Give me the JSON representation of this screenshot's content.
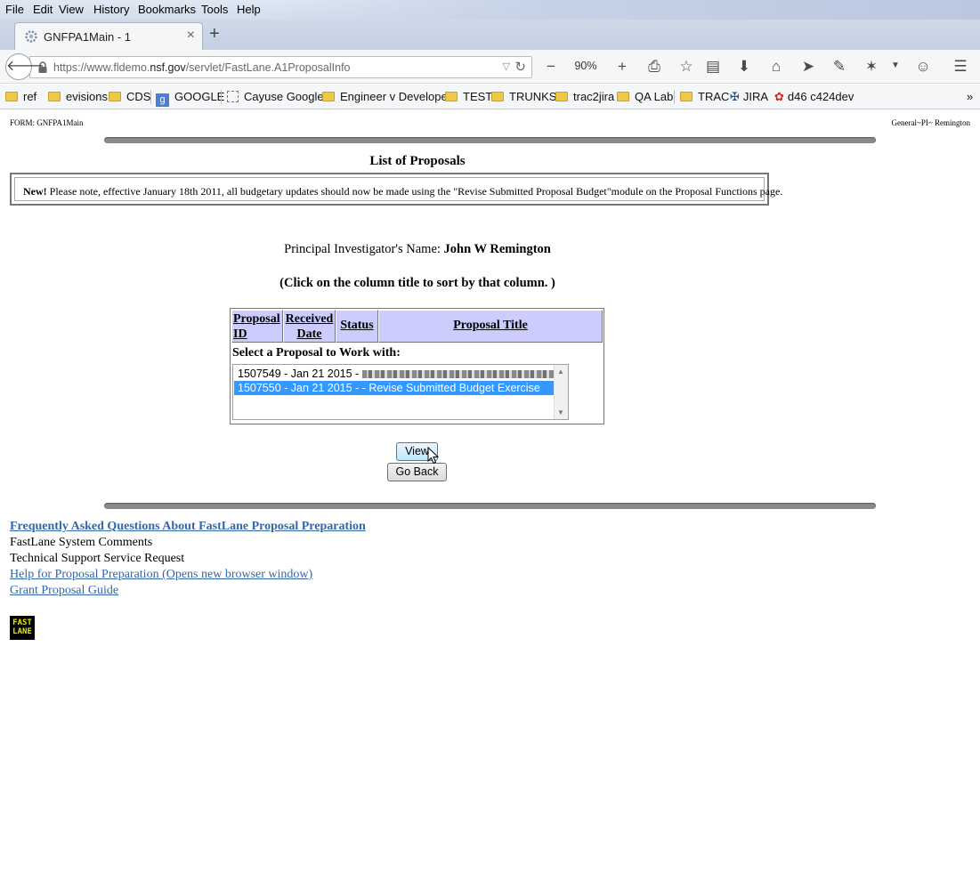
{
  "menubar": {
    "items": [
      "File",
      "Edit",
      "View",
      "History",
      "Bookmarks",
      "Tools",
      "Help"
    ]
  },
  "tabs": {
    "active_title": "GNFPA1Main - 1",
    "close_glyph": "×",
    "new_tab_glyph": "+"
  },
  "navbar": {
    "url_prefix": "https://www.fldemo.",
    "url_domain": "nsf.gov",
    "url_path": "/servlet/FastLane.A1ProposalInfo",
    "zoom": "90%"
  },
  "bookmarks": {
    "items": [
      "ref",
      "evisions",
      "CDS",
      "GOOGLE",
      "Cayuse Google",
      "Engineer v Developer",
      "TEST",
      "TRUNKS",
      "trac2jira",
      "QA Lab",
      "TRAC",
      "JIRA",
      "d46 c424dev"
    ],
    "overflow_glyph": "»"
  },
  "page": {
    "form_label": "FORM: GNFPA1Main",
    "user_label": "General~PI~ Remington",
    "title": "List of Proposals",
    "notice_new": "New!",
    "notice_text": " Please note, effective January 18th 2011, all budgetary updates should now be made using the \"Revise Submitted Proposal Budget\"module on the Proposal Functions page.",
    "pi_label": "Principal Investigator's Name: ",
    "pi_name": "John W Remington",
    "click_hint": "(Click on the column title to sort by that column. )",
    "table": {
      "col_proposal_id": "Proposal ID",
      "col_received_date": "Received Date",
      "col_status": "Status",
      "col_proposal_title": "Proposal Title",
      "select_label": "Select a Proposal to Work with:",
      "options": [
        {
          "text": "1507549 - Jan 21 2015 - ",
          "selected": false
        },
        {
          "text": "1507550 - Jan 21 2015 - - Revise Submitted Budget Exercise",
          "selected": true
        }
      ]
    },
    "view_button": "View",
    "go_back_button": "Go Back",
    "links": {
      "faq": "Frequently Asked Questions About FastLane Proposal Preparation",
      "system_comments": "FastLane System Comments",
      "tech_support": "Technical Support Service Request",
      "help": "Help for Proposal Preparation  (Opens new browser window)",
      "grant_guide": "Grant Proposal Guide"
    },
    "logo_text": "FAST LANE"
  },
  "colors": {
    "table_header": "#ccccff",
    "selected_option": "#3399ff",
    "link": "#3366aa",
    "rule": "#8a8a8a"
  }
}
